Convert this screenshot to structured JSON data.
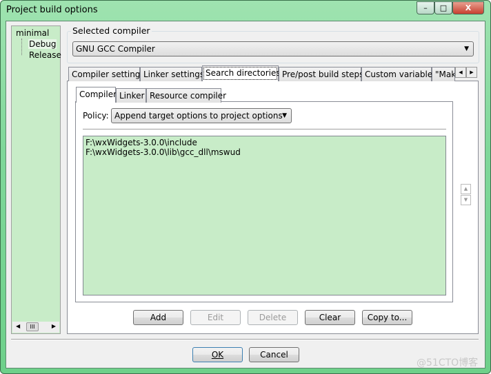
{
  "window": {
    "title": "Project build options",
    "minimize": "–",
    "maximize": "□",
    "close": "X"
  },
  "tree": {
    "root": "minimal",
    "children": [
      "Debug",
      "Release"
    ],
    "selected": "Debug"
  },
  "compiler": {
    "group_label": "Selected compiler",
    "value": "GNU GCC Compiler"
  },
  "tabs": [
    "Compiler settings",
    "Linker settings",
    "Search directories",
    "Pre/post build steps",
    "Custom variables",
    "\"Make"
  ],
  "active_tab": "Search directories",
  "subtabs": [
    "Compiler",
    "Linker",
    "Resource compiler"
  ],
  "active_subtab": "Compiler",
  "policy": {
    "label": "Policy:",
    "value": "Append target options to project options"
  },
  "directories": [
    "F:\\wxWidgets-3.0.0\\include",
    "F:\\wxWidgets-3.0.0\\lib\\gcc_dll\\mswud"
  ],
  "buttons": {
    "add": "Add",
    "edit": "Edit",
    "delete": "Delete",
    "clear": "Clear",
    "copy": "Copy to..."
  },
  "dialog": {
    "ok": "OK",
    "cancel": "Cancel"
  },
  "watermark": "@51CTO博客",
  "colors": {
    "list_bg": "#c8ecc8",
    "frame": "#7fd79a"
  }
}
